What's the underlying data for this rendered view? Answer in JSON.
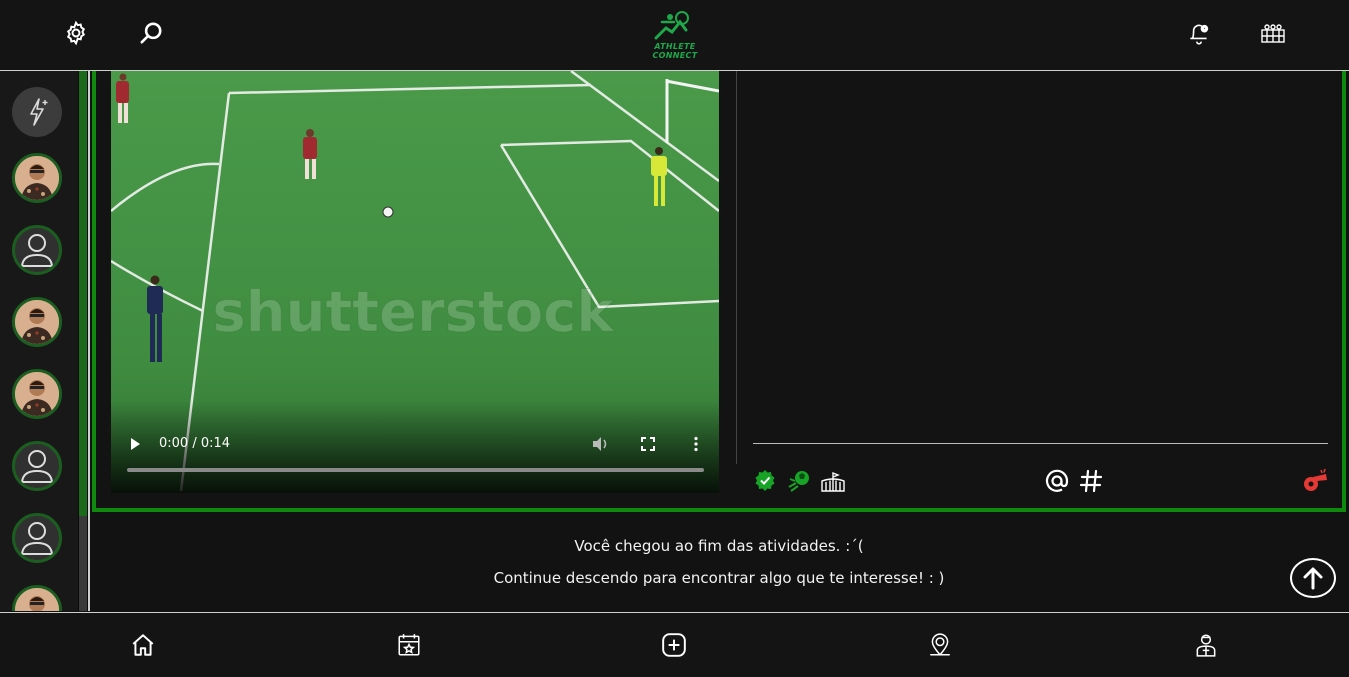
{
  "header": {
    "logo_text": "ATHLETE CONNECT",
    "icons": [
      "gear-icon",
      "search-icon",
      "notification-bell-icon",
      "team-lineup-icon"
    ]
  },
  "sidebar": {
    "items": [
      "flash-icon",
      "avatar",
      "avatar-placeholder",
      "avatar",
      "avatar",
      "avatar-placeholder",
      "avatar-placeholder",
      "avatar"
    ]
  },
  "video": {
    "watermark": "shutterstock",
    "time": "0:00 / 0:14",
    "progress": 0
  },
  "post_actions": {
    "icons": [
      "medal-icon",
      "kick-ball-icon",
      "stadium-icon",
      "mention-icon",
      "hashtag-icon",
      "whistle-icon"
    ]
  },
  "feed": {
    "end_line1": "Você chegou ao fim das atividades. :´(",
    "end_line2": "Continue descendo para encontrar algo que te interesse! : )"
  },
  "bottom_nav": {
    "icons": [
      "home-icon",
      "calendar-star-icon",
      "add-post-icon",
      "location-pin-icon",
      "athlete-profile-icon"
    ]
  },
  "colors": {
    "accent": "#0f8a0f",
    "background": "#121212",
    "whistle": "#e53935"
  }
}
